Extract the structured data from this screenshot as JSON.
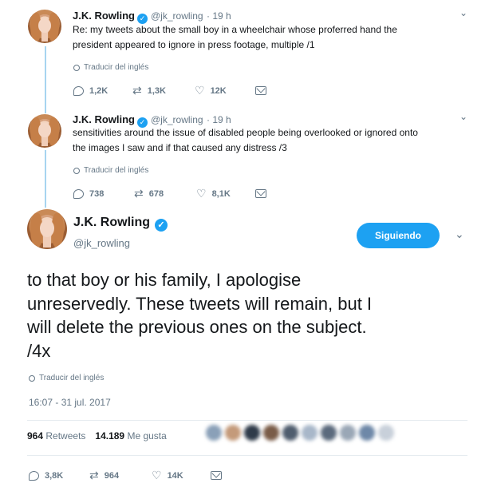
{
  "tweet1": {
    "name": "J.K. Rowling",
    "handle": "@jk_rowling",
    "time": "· 19 h",
    "text_line1": "Re: my tweets about the small boy in a wheelchair whose proferred hand the",
    "text_line2": "president appeared to ignore in press footage, multiple /1",
    "translate": "Traducir del inglés",
    "replies": "1,2K",
    "retweets": "1,3K",
    "likes": "12K"
  },
  "tweet2": {
    "name": "J.K. Rowling",
    "handle": "@jk_rowling",
    "time": "· 19 h",
    "text_line1": "sensitivities around the issue of disabled people being overlooked or ignored onto",
    "text_line2": "the images I saw and if that caused any distress /3",
    "translate": "Traducir del inglés",
    "replies": "738",
    "retweets": "678",
    "likes": "8,1K"
  },
  "main": {
    "name": "J.K. Rowling",
    "handle": "@jk_rowling",
    "follow_label": "Siguiendo",
    "text_line1": "to that boy or his family, I apologise",
    "text_line2": "unreservedly. These tweets will remain, but I",
    "text_line3": "will delete the previous ones on the subject.",
    "text_line4": "/4x",
    "translate": "Traducir del inglés",
    "timestamp": "16:07 - 31 jul. 2017",
    "retweets_count": "964",
    "retweets_label": "Retweets",
    "likes_count": "14.189",
    "likes_label": "Me gusta",
    "replies": "3,8K",
    "retweets": "964",
    "likes": "14K"
  },
  "colors": {
    "accent": "#1da1f2",
    "thread_line": "#a7d4f0",
    "muted": "#657786"
  }
}
